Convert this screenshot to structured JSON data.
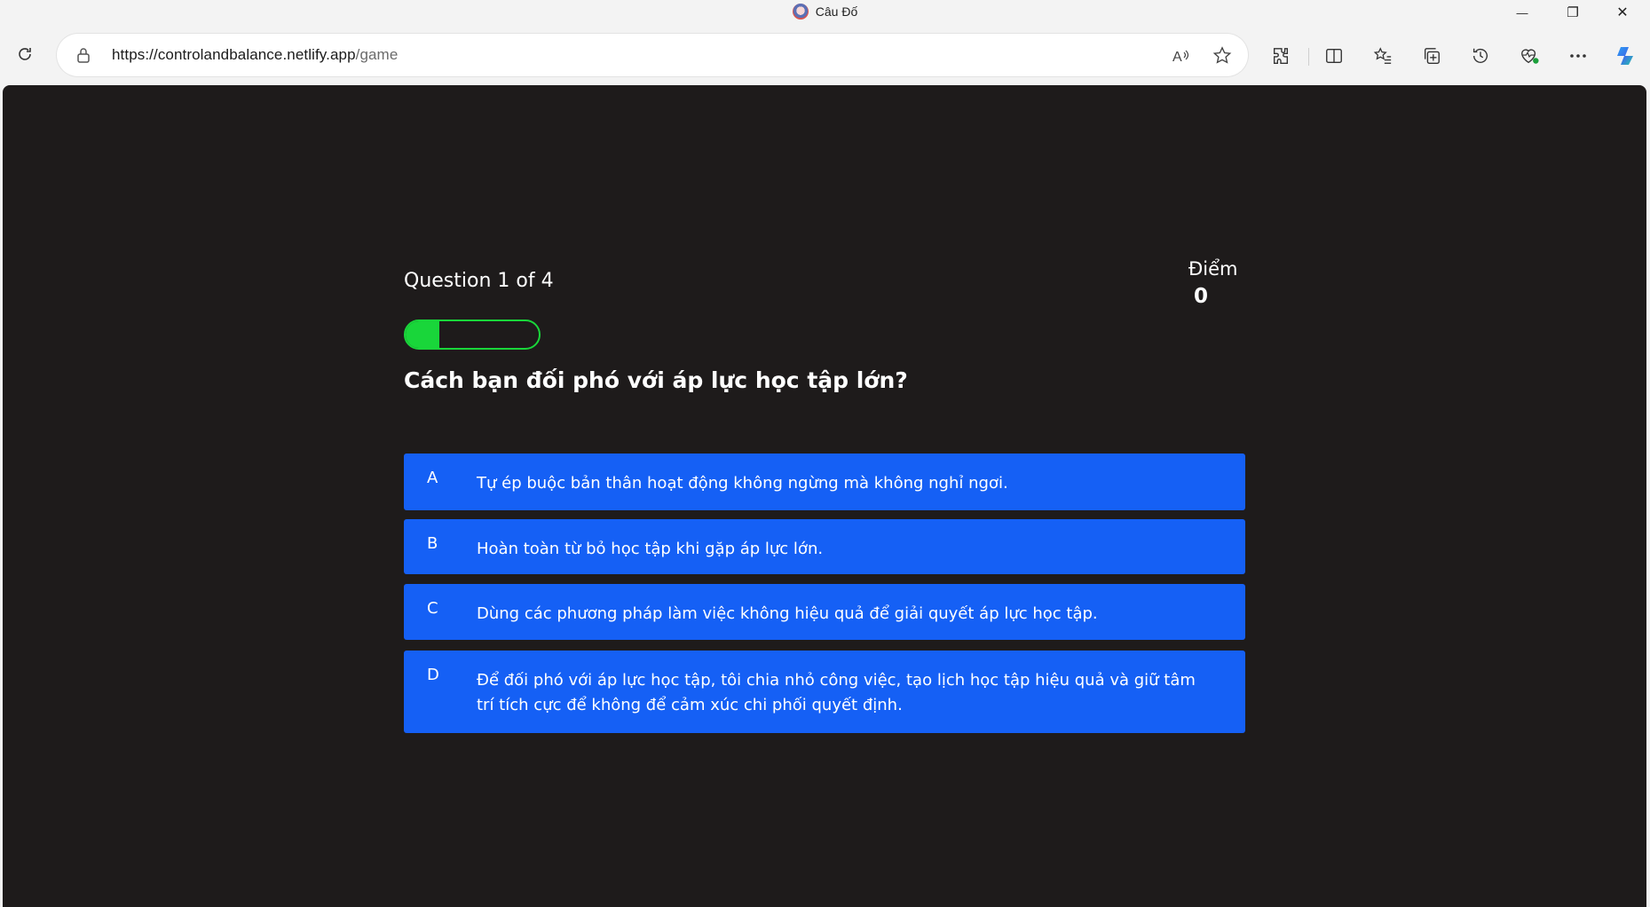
{
  "window": {
    "title": "Câu Đố",
    "controls": {
      "minimize_icon": "—",
      "restore_icon": "❐",
      "close_icon": "✕"
    }
  },
  "browser": {
    "url_host": "https://controlandbalance.netlify.app",
    "url_path": "/game",
    "toolbar_icons": [
      "read-aloud-icon",
      "favorite-star-icon",
      "extensions-icon",
      "split-screen-icon",
      "favorites-icon",
      "collections-icon",
      "history-icon",
      "browser-essentials-icon",
      "more-icon",
      "copilot-icon"
    ]
  },
  "quiz": {
    "question_counter": "Question 1 of 4",
    "progress_fraction": 0.25,
    "score_label": "Điểm",
    "score_value": "0",
    "question": "Cách bạn đối phó với áp lực học tập lớn?",
    "answers": [
      {
        "letter": "A",
        "text": "Tự ép buộc bản thân hoạt động không ngừng mà không nghỉ ngơi."
      },
      {
        "letter": "B",
        "text": "Hoàn toàn từ bỏ học tập khi gặp áp lực lớn."
      },
      {
        "letter": "C",
        "text": "Dùng các phương pháp làm việc không hiệu quả để giải quyết áp lực học tập."
      },
      {
        "letter": "D",
        "text": "Để đối phó với áp lực học tập, tôi chia nhỏ công việc, tạo lịch học tập hiệu quả và giữ tâm trí tích cực để không để cảm xúc chi phối quyết định."
      }
    ]
  },
  "colors": {
    "page_background": "#1e1b1b",
    "answer_button": "#1560f5",
    "progress": "#19d63a",
    "text": "#ffffff"
  }
}
